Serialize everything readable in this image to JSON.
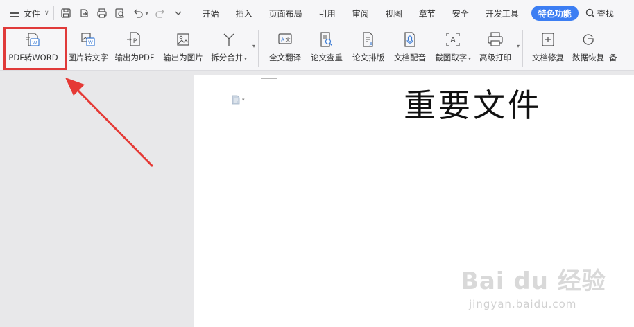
{
  "menubar": {
    "file_label": "文件",
    "tabs": [
      "开始",
      "插入",
      "页面布局",
      "引用",
      "审阅",
      "视图",
      "章节",
      "安全",
      "开发工具"
    ],
    "special_tab": "特色功能",
    "search_label": "查找"
  },
  "ribbon": {
    "buttons": [
      {
        "label": "PDF转WORD",
        "icon": "pdf-to-word-icon"
      },
      {
        "label": "图片转文字",
        "icon": "image-to-text-icon"
      },
      {
        "label": "输出为PDF",
        "icon": "export-pdf-icon"
      },
      {
        "label": "输出为图片",
        "icon": "export-image-icon"
      },
      {
        "label": "拆分合并",
        "icon": "split-merge-icon"
      },
      {
        "label": "全文翻译",
        "icon": "translate-icon"
      },
      {
        "label": "论文查重",
        "icon": "paper-check-icon"
      },
      {
        "label": "论文排版",
        "icon": "paper-format-icon"
      },
      {
        "label": "文档配音",
        "icon": "microphone-icon"
      },
      {
        "label": "截图取字",
        "icon": "screenshot-ocr-icon"
      },
      {
        "label": "高级打印",
        "icon": "print-icon"
      },
      {
        "label": "文档修复",
        "icon": "doc-repair-icon"
      },
      {
        "label": "数据恢复",
        "icon": "data-recovery-icon"
      },
      {
        "label": "备",
        "icon": "backup-icon"
      }
    ]
  },
  "document": {
    "title": "重要文件"
  },
  "watermark": {
    "logo": "Bai du 经验",
    "url": "jingyan.baidu.com"
  },
  "colors": {
    "highlight": "#e03a3a",
    "special_tab_bg": "#3c7ef3",
    "accent_icon": "#3a7bd5"
  }
}
